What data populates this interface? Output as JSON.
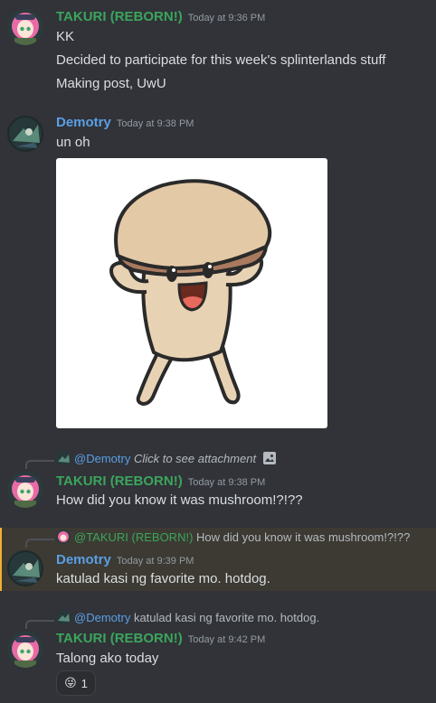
{
  "users": {
    "takuri": {
      "name": "TAKURI (REBORN!)",
      "color": "#3ba55c"
    },
    "demotry": {
      "name": "Demotry",
      "color": "#5a9fe6"
    }
  },
  "messages": [
    {
      "author": "TAKURI (REBORN!)",
      "time": "Today at 9:36 PM",
      "lines": [
        "KK",
        "Decided to participate for this week's splinterlands stuff",
        "Making post, UwU"
      ]
    },
    {
      "author": "Demotry",
      "time": "Today at 9:38 PM",
      "lines": [
        "un oh"
      ],
      "attachment": "mushroom-cartoon-image"
    },
    {
      "author": "TAKURI (REBORN!)",
      "time": "Today at 9:38 PM",
      "reply": {
        "author": "@Demotry",
        "text": "Click to see attachment"
      },
      "lines": [
        "How did you know it was mushroom!?!??"
      ]
    },
    {
      "author": "Demotry",
      "time": "Today at 9:39 PM",
      "reply": {
        "author": "@TAKURI (REBORN!)",
        "text": "How did you know it was mushroom!?!??"
      },
      "lines": [
        "katulad kasi ng favorite mo. hotdog."
      ],
      "highlighted": true
    },
    {
      "author": "TAKURI (REBORN!)",
      "time": "Today at 9:42 PM",
      "reply": {
        "author": "@Demotry",
        "text": "katulad kasi ng favorite mo. hotdog."
      },
      "lines": [
        "Talong ako today"
      ],
      "reaction": {
        "emoji": "😜",
        "count": "1"
      }
    }
  ]
}
